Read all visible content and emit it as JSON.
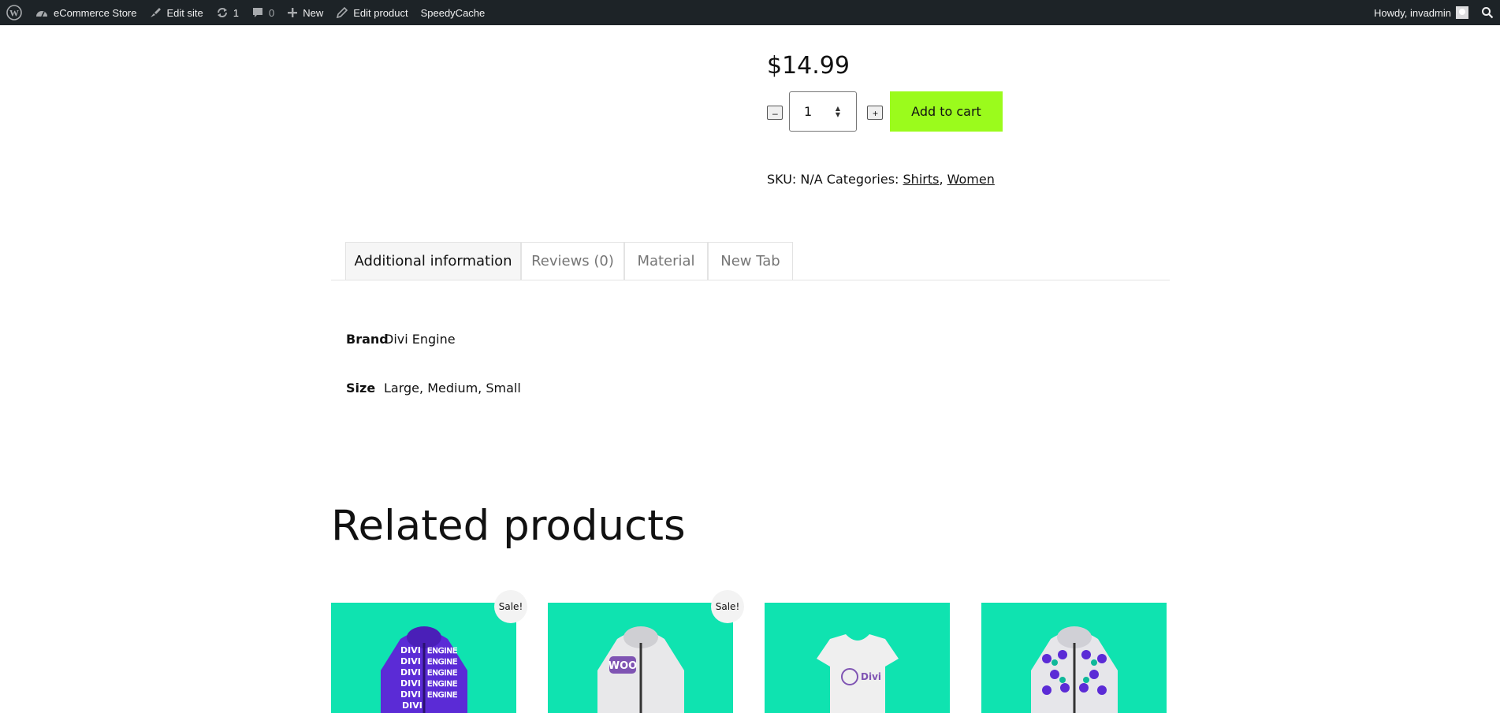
{
  "adminbar": {
    "site_name": "eCommerce Store",
    "edit_site": "Edit site",
    "updates_count": "1",
    "comments_count": "0",
    "new_label": "New",
    "edit_product": "Edit product",
    "speedycache": "SpeedyCache",
    "howdy": "Howdy, invadmin"
  },
  "product": {
    "price": "$14.99",
    "qty_minus": "–",
    "qty_plus": "+",
    "qty_value": "1",
    "add_to_cart": "Add to cart",
    "sku_text": "SKU: N/A Categories: ",
    "category_1": "Shirts",
    "category_sep": ", ",
    "category_2": "Women"
  },
  "tabs": [
    {
      "label": "Additional information",
      "active": true
    },
    {
      "label": "Reviews (0)"
    },
    {
      "label": "Material"
    },
    {
      "label": "New Tab"
    }
  ],
  "attributes": [
    {
      "name": "Brand",
      "value": "Divi Engine"
    },
    {
      "name": "Size",
      "value": "Large, Medium, Small"
    }
  ],
  "related": {
    "title": "Related products",
    "sale_label": "Sale!"
  },
  "colors": {
    "adminbar_bg": "#1d2327",
    "add_to_cart_bg": "#9bfb1c",
    "card_bg": "#0fe3b0",
    "hoodie_purple": "#5b2bd6"
  }
}
